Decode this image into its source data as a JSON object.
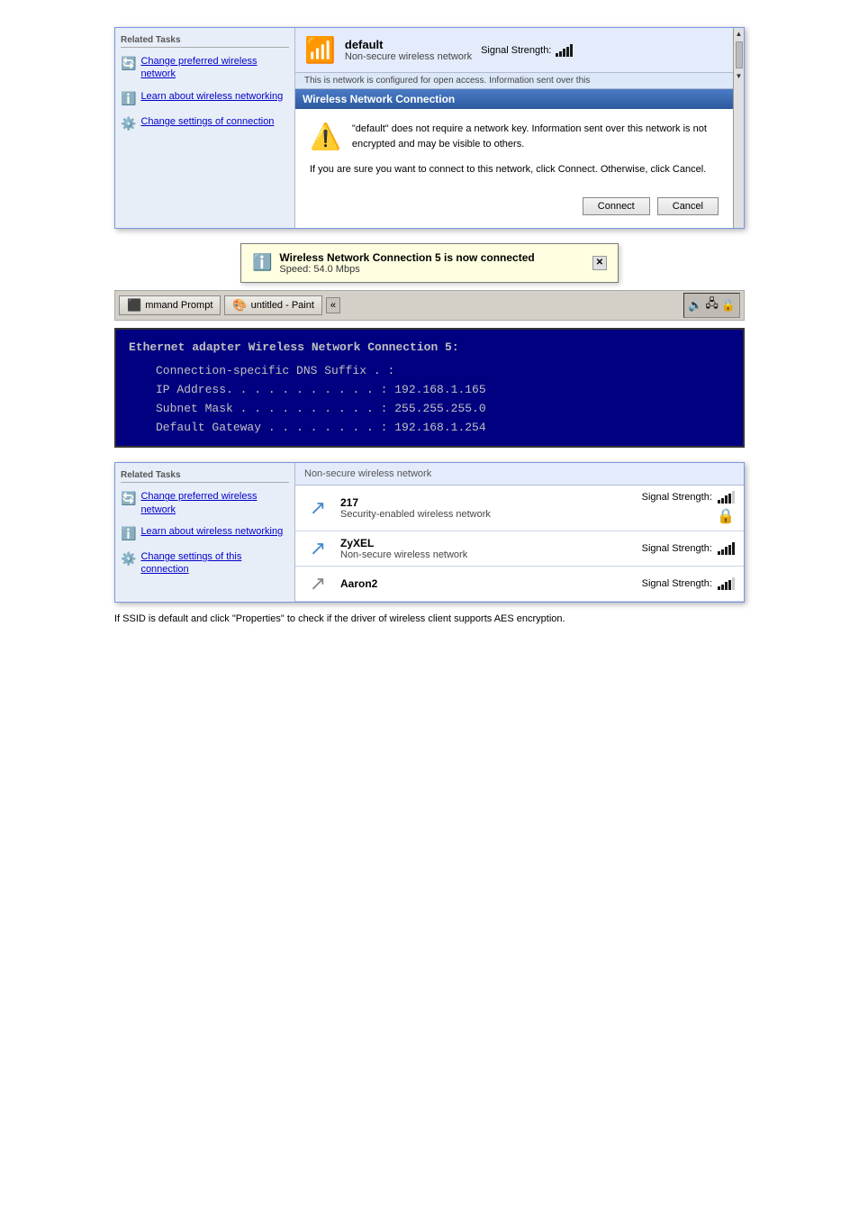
{
  "panel1": {
    "sidebar_title": "Related Tasks",
    "links": [
      {
        "icon": "🔄",
        "text": "Change preferred wireless network"
      },
      {
        "icon": "ℹ️",
        "text": "Learn about wireless networking"
      },
      {
        "icon": "⚙️",
        "text": "Change settings of connection"
      }
    ],
    "network_name": "default",
    "network_type": "Non-secure wireless network",
    "signal_label": "Signal Strength:",
    "info_bar": "This is network is configured for open access. Information sent over this",
    "dialog_title": "Wireless Network Connection",
    "warning_text": "\"default\" does not require a network key. Information sent over this network is not encrypted and may be visible to others.",
    "second_para": "If you are sure you want to connect to this network, click Connect. Otherwise, click Cancel.",
    "btn_connect": "Connect",
    "btn_cancel": "Cancel"
  },
  "notification": {
    "title": "Wireless Network Connection 5 is now connected",
    "sub": "Speed: 54.0 Mbps"
  },
  "taskbar": {
    "btn1_label": "mmand Prompt",
    "btn2_label": "untitled - Paint",
    "overflow": "«",
    "tray_icons": [
      "🔊",
      "🖧",
      "🔒"
    ]
  },
  "cmd": {
    "header": "Ethernet adapter Wireless Network Connection 5:",
    "lines": [
      "Connection-specific DNS Suffix  . :",
      "IP Address. . . . . . . . . . . : 192.168.1.165",
      "Subnet Mask . . . . . . . . . . : 255.255.255.0",
      "Default Gateway . . . . . . . . : 192.168.1.254"
    ]
  },
  "panel2": {
    "sidebar_title": "Related Tasks",
    "links": [
      {
        "icon": "🔄",
        "text": "Change preferred wireless network"
      },
      {
        "icon": "ℹ️",
        "text": "Learn about wireless networking"
      },
      {
        "icon": "⚙️",
        "text": "Change settings of this connection"
      }
    ],
    "header_text": "Non-secure wireless network",
    "networks": [
      {
        "name": "217",
        "type": "Security-enabled wireless network",
        "signal": 4,
        "locked": true
      },
      {
        "name": "ZyXEL",
        "type": "Non-secure wireless network",
        "signal": 5,
        "locked": false
      },
      {
        "name": "Aaron2",
        "type": "",
        "signal": 4,
        "locked": false
      }
    ]
  },
  "caption": "If SSID is default and click \"Properties\" to check if the driver of wireless client supports AES encryption."
}
